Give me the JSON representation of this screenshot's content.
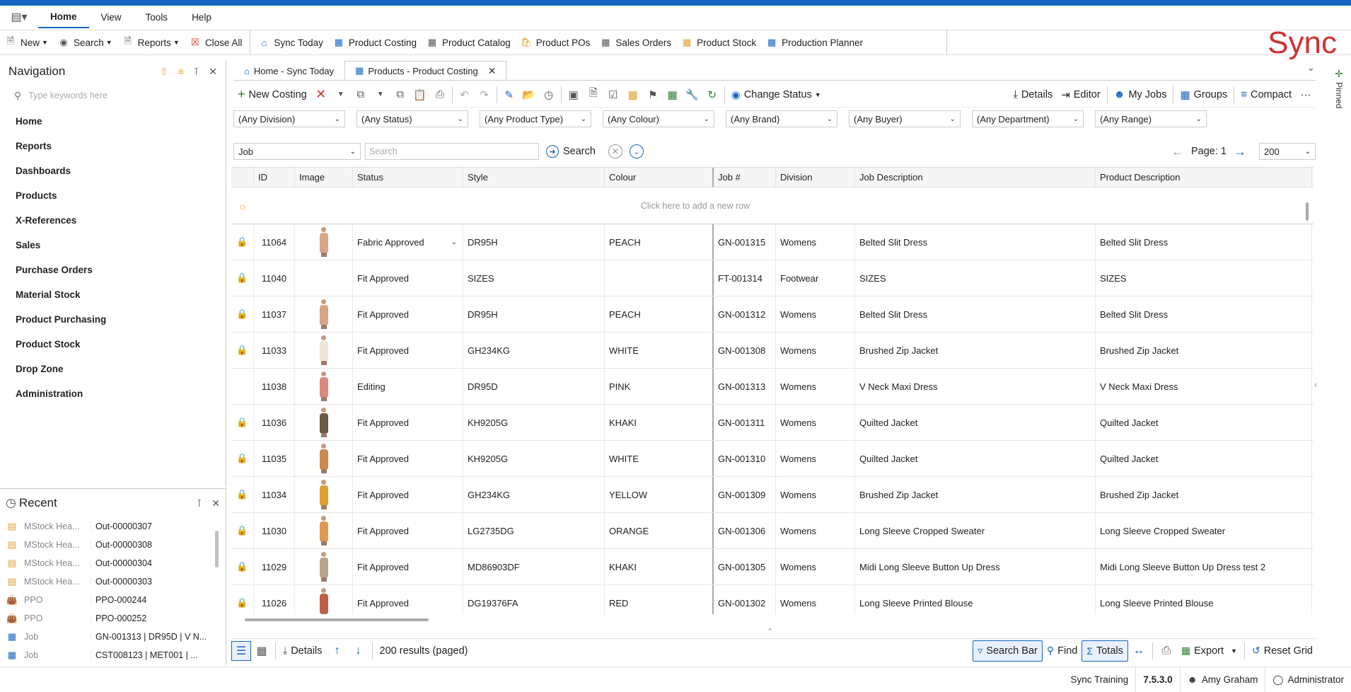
{
  "colors": {
    "accent": "#1565c0",
    "brand": "#d32f2f",
    "lock": "#e0a030"
  },
  "menubar": {
    "items": [
      {
        "label": "Home",
        "active": true
      },
      {
        "label": "View"
      },
      {
        "label": "Tools"
      },
      {
        "label": "Help"
      }
    ]
  },
  "toolbar": {
    "new": "New",
    "search": "Search",
    "reports": "Reports",
    "close_all": "Close All",
    "shortcuts": [
      "Sync Today",
      "Product Costing",
      "Product Catalog",
      "Product POs",
      "Sales Orders",
      "Product Stock",
      "Production Planner"
    ]
  },
  "logo": {
    "text": "Sync"
  },
  "navigation": {
    "title": "Navigation",
    "search_placeholder": "Type keywords here",
    "items": [
      "Home",
      "Reports",
      "Dashboards",
      "Products",
      "X-References",
      "Sales",
      "Purchase Orders",
      "Material Stock",
      "Product Purchasing",
      "Product Stock",
      "Drop Zone",
      "Administration"
    ]
  },
  "recent": {
    "title": "Recent",
    "rows": [
      {
        "type": "MStock Hea...",
        "value": "Out-00000307",
        "icon": "stock-out-icon"
      },
      {
        "type": "MStock Hea...",
        "value": "Out-00000308",
        "icon": "stock-icon"
      },
      {
        "type": "MStock Hea...",
        "value": "Out-00000304",
        "icon": "stock-icon"
      },
      {
        "type": "MStock Hea...",
        "value": "Out-00000303",
        "icon": "stock-icon"
      },
      {
        "type": "PPO",
        "value": "PPO-000244",
        "icon": "bag-icon"
      },
      {
        "type": "PPO",
        "value": "PPO-000252",
        "icon": "bag-icon"
      },
      {
        "type": "Job",
        "value": "GN-001313 | DR95D | V N...",
        "icon": "grid-icon"
      },
      {
        "type": "Job",
        "value": "CST008123 | MET001 | ...",
        "icon": "grid-icon"
      }
    ]
  },
  "doc_tabs": [
    {
      "label": "Home - Sync Today",
      "active": false
    },
    {
      "label": "Products - Product Costing",
      "active": true
    }
  ],
  "pinned_label": "Pinned",
  "actions": {
    "new_costing": "New Costing",
    "change_status": "Change Status",
    "details": "Details",
    "editor": "Editor",
    "my_jobs": "My Jobs",
    "groups": "Groups",
    "compact": "Compact"
  },
  "filters": [
    "(Any Division)",
    "(Any Status)",
    "(Any Product Type)",
    "(Any Colour)",
    "(Any Brand)",
    "(Any Buyer)",
    "(Any Department)",
    "(Any Range)"
  ],
  "search": {
    "field": "Job",
    "placeholder": "Search",
    "button": "Search",
    "page_label": "Page: 1",
    "page_size": "200"
  },
  "grid": {
    "columns": [
      "ID",
      "Image",
      "Status",
      "Style",
      "Colour",
      "Job #",
      "Division",
      "Job Description",
      "Product Description"
    ],
    "new_row_text": "Click here to add a new row",
    "rows": [
      {
        "locked": true,
        "id": "11064",
        "img": "#d9a58a",
        "status": "Fabric Approved",
        "dd": true,
        "style": "DR95H",
        "colour": "PEACH",
        "job": "GN-001315",
        "division": "Womens",
        "jd": "Belted Slit Dress",
        "pd": "Belted Slit Dress"
      },
      {
        "locked": true,
        "id": "11040",
        "img": "",
        "status": "Fit Approved",
        "style": "SIZES",
        "colour": "",
        "job": "FT-001314",
        "division": "Footwear",
        "jd": "SIZES",
        "pd": "SIZES"
      },
      {
        "locked": true,
        "id": "11037",
        "img": "#d9a58a",
        "status": "Fit Approved",
        "style": "DR95H",
        "colour": "PEACH",
        "job": "GN-001312",
        "division": "Womens",
        "jd": "Belted Slit Dress",
        "pd": "Belted Slit Dress"
      },
      {
        "locked": true,
        "id": "11033",
        "img": "#efe6d8",
        "status": "Fit Approved",
        "style": "GH234KG",
        "colour": "WHITE",
        "job": "GN-001308",
        "division": "Womens",
        "jd": "Brushed Zip Jacket",
        "pd": "Brushed Zip Jacket"
      },
      {
        "locked": false,
        "id": "11038",
        "img": "#d98a80",
        "status": "Editing",
        "style": "DR95D",
        "colour": "PINK",
        "job": "GN-001313",
        "division": "Womens",
        "jd": "V Neck Maxi Dress",
        "pd": "V Neck Maxi Dress"
      },
      {
        "locked": true,
        "id": "11036",
        "img": "#6b5a40",
        "status": "Fit Approved",
        "style": "KH9205G",
        "colour": "KHAKI",
        "job": "GN-001311",
        "division": "Womens",
        "jd": "Quilted Jacket",
        "pd": "Quilted Jacket"
      },
      {
        "locked": true,
        "id": "11035",
        "img": "#c98a50",
        "status": "Fit Approved",
        "style": "KH9205G",
        "colour": "WHITE",
        "job": "GN-001310",
        "division": "Womens",
        "jd": "Quilted Jacket",
        "pd": "Quilted Jacket"
      },
      {
        "locked": true,
        "id": "11034",
        "img": "#e0a030",
        "status": "Fit Approved",
        "style": "GH234KG",
        "colour": "YELLOW",
        "job": "GN-001309",
        "division": "Womens",
        "jd": "Brushed Zip Jacket",
        "pd": "Brushed Zip Jacket"
      },
      {
        "locked": true,
        "id": "11030",
        "img": "#e09a50",
        "status": "Fit Approved",
        "style": "LG2735DG",
        "colour": "ORANGE",
        "job": "GN-001306",
        "division": "Womens",
        "jd": "Long Sleeve Cropped Sweater",
        "pd": "Long Sleeve Cropped Sweater"
      },
      {
        "locked": true,
        "id": "11029",
        "img": "#b8a58a",
        "status": "Fit Approved",
        "style": "MD86903DF",
        "colour": "KHAKI",
        "job": "GN-001305",
        "division": "Womens",
        "jd": "Midi Long Sleeve Button Up Dress",
        "pd": "Midi Long Sleeve Button Up Dress test 2"
      },
      {
        "locked": true,
        "id": "11026",
        "img": "#c0604a",
        "status": "Fit Approved",
        "style": "DG19376FA",
        "colour": "RED",
        "job": "GN-001302",
        "division": "Womens",
        "jd": "Long Sleeve Printed Blouse",
        "pd": "Long Sleeve Printed Blouse"
      }
    ]
  },
  "bottombar": {
    "details": "Details",
    "results": "200 results (paged)",
    "search_bar": "Search Bar",
    "find": "Find",
    "totals": "Totals",
    "export": "Export",
    "reset_grid": "Reset Grid"
  },
  "statusbar": {
    "env": "Sync Training",
    "version": "7.5.3.0",
    "user": "Amy Graham",
    "role": "Administrator"
  }
}
